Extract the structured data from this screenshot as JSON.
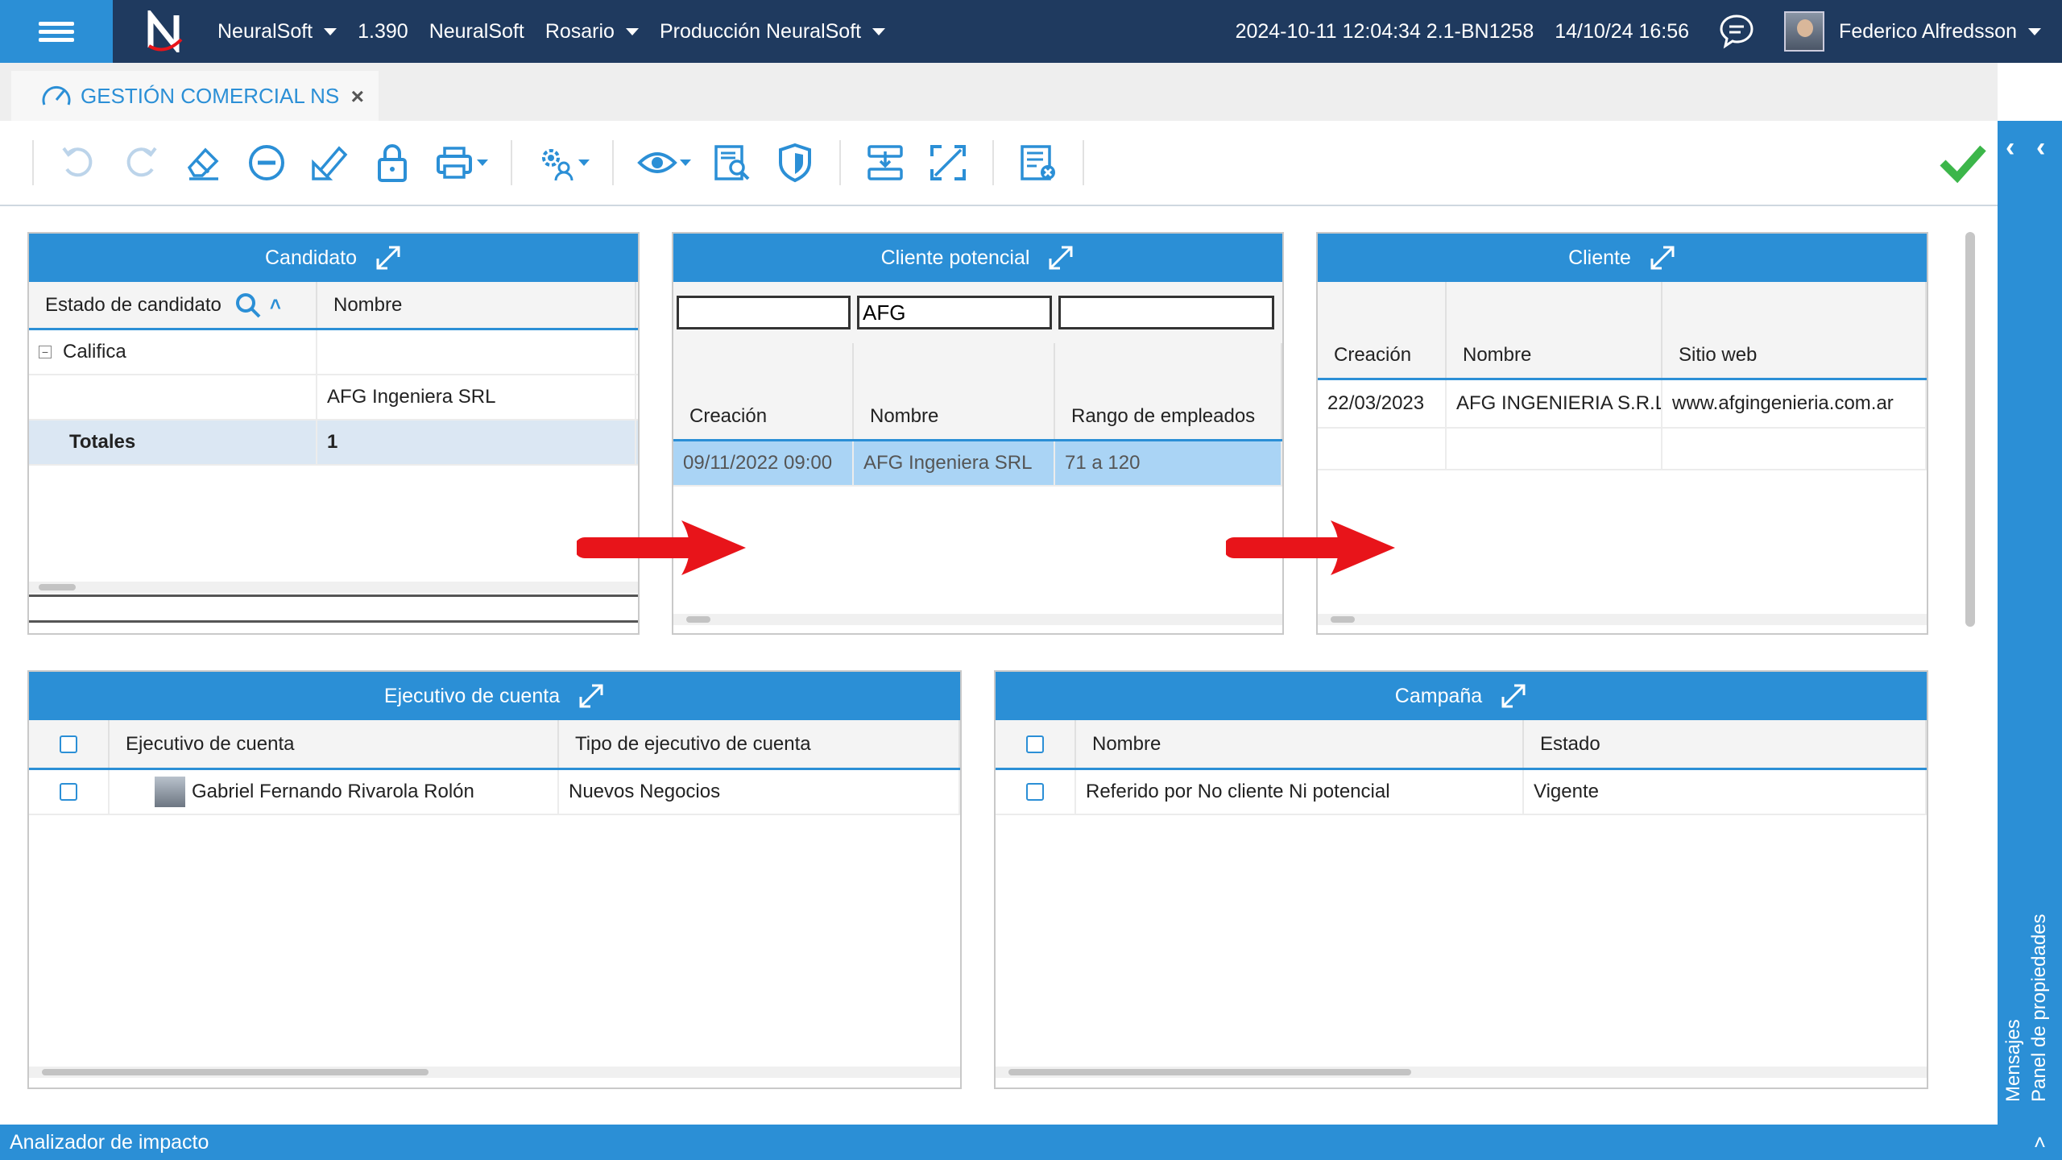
{
  "topbar": {
    "company": "NeuralSoft",
    "version": "1.390",
    "company2": "NeuralSoft",
    "location": "Rosario",
    "environment": "Producción NeuralSoft",
    "build": "2024-10-11 12:04:34 2.1-BN1258",
    "datetime": "14/10/24 16:56",
    "user": "Federico Alfredsson"
  },
  "tab": {
    "label": "GESTIÓN COMERCIAL NS",
    "close": "×"
  },
  "colors": {
    "accent": "#2b8fd6",
    "topbar": "#1f3a5f",
    "selected_row": "#aad4f5",
    "check": "#3cb64a",
    "arrow": "#e8141a"
  },
  "panels": {
    "candidato": {
      "title": "Candidato",
      "columns": [
        "Estado de candidato",
        "Nombre"
      ],
      "group": "Califica",
      "rows": [
        [
          "",
          "AFG Ingeniera SRL"
        ]
      ],
      "totals_label": "Totales",
      "totals_value": "1"
    },
    "cliente_potencial": {
      "title": "Cliente potencial",
      "filters": [
        "",
        "AFG",
        ""
      ],
      "columns": [
        "Creación",
        "Nombre",
        "Rango de empleados"
      ],
      "rows": [
        [
          "09/11/2022 09:00",
          "AFG Ingeniera SRL",
          "71 a 120"
        ]
      ]
    },
    "cliente": {
      "title": "Cliente",
      "columns": [
        "Creación",
        "Nombre",
        "Sitio web"
      ],
      "rows": [
        [
          "22/03/2023",
          "AFG INGENIERIA S.R.L.",
          "www.afgingenieria.com.ar"
        ]
      ]
    },
    "ejecutivo": {
      "title": "Ejecutivo de cuenta",
      "columns": [
        "Ejecutivo de cuenta",
        "Tipo de ejecutivo de cuenta"
      ],
      "rows": [
        [
          "Gabriel Fernando Rivarola Rolón",
          "Nuevos Negocios"
        ]
      ]
    },
    "campana": {
      "title": "Campaña",
      "columns": [
        "Nombre",
        "Estado"
      ],
      "rows": [
        [
          "Referido por No cliente Ni potencial",
          "Vigente"
        ]
      ]
    }
  },
  "sidebar": {
    "messages": "Mensajes",
    "properties": "Panel de propiedades"
  },
  "statusbar": {
    "label": "Analizador de impacto"
  }
}
